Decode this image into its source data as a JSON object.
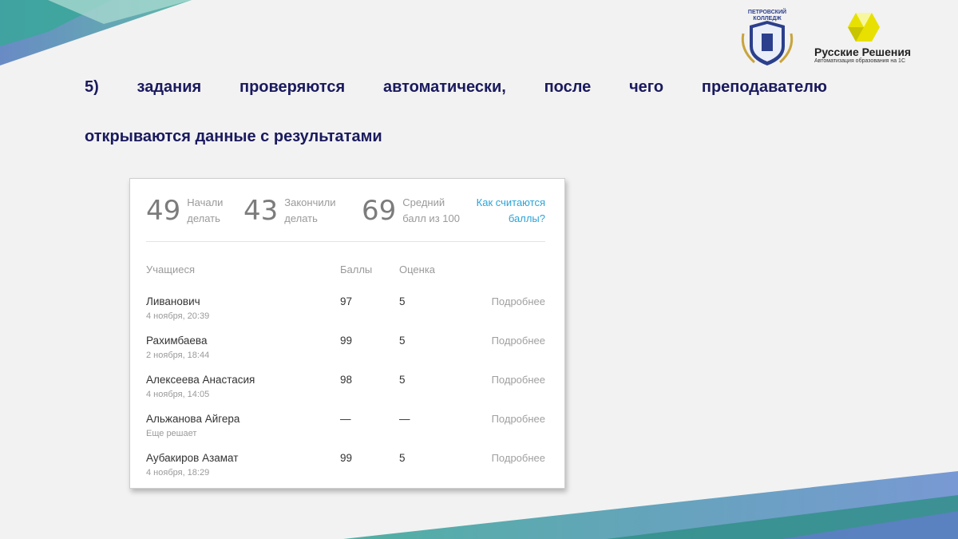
{
  "heading": {
    "line1": "5) задания проверяются автоматически, после чего преподавателю",
    "line2": "открываются данные с результатами"
  },
  "logos": {
    "college": {
      "name": "ПЕТРОВСКИЙ КОЛЛЕДЖ",
      "icon": "college-crest-icon"
    },
    "brand": {
      "title": "Русские Решения",
      "subtitle": "Автоматизация образования на 1С",
      "icon": "hexagon-mark-icon"
    }
  },
  "stats": {
    "started": {
      "value": "49",
      "label1": "Начали",
      "label2": "делать"
    },
    "finished": {
      "value": "43",
      "label1": "Закончили",
      "label2": "делать"
    },
    "average": {
      "value": "69",
      "label1": "Средний",
      "label2": "балл из 100"
    },
    "how_link1": "Как считаются",
    "how_link2": "баллы?"
  },
  "table": {
    "headers": {
      "students": "Учащиеся",
      "score": "Баллы",
      "grade": "Оценка"
    },
    "rows": [
      {
        "name": "Ливанович",
        "time": "4 ноября, 20:39",
        "score": "97",
        "grade": "5",
        "more": "Подробнее"
      },
      {
        "name": "Рахимбаева",
        "time": "2 ноября, 18:44",
        "score": "99",
        "grade": "5",
        "more": "Подробнее"
      },
      {
        "name": "Алексеева Анастасия",
        "time": "4 ноября, 14:05",
        "score": "98",
        "grade": "5",
        "more": "Подробнее"
      },
      {
        "name": "Альжанова Айгера",
        "time": "Еще решает",
        "score": "—",
        "grade": "—",
        "more": "Подробнее"
      },
      {
        "name": "Аубакиров Азамат",
        "time": "4 ноября, 18:29",
        "score": "99",
        "grade": "5",
        "more": "Подробнее"
      }
    ]
  },
  "colors": {
    "heading": "#1a1a5e",
    "link": "#2aa4d8",
    "accent_teal": "#3aa79a",
    "accent_blue": "#4f7fb8",
    "brand_yellow": "#e8e000"
  }
}
